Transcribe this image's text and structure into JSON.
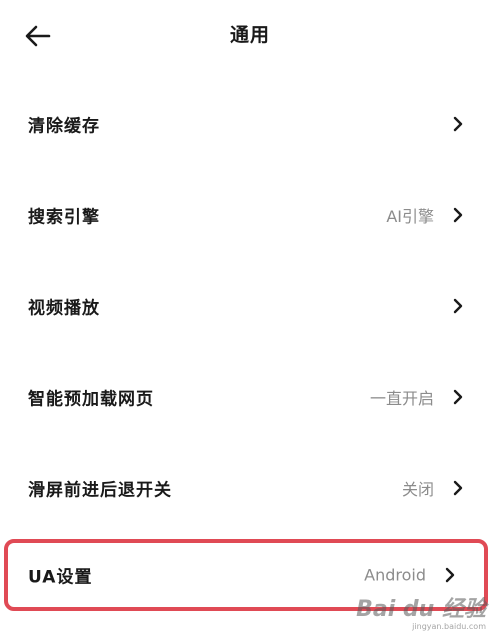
{
  "header": {
    "title": "通用",
    "back_icon": "arrow-left-icon"
  },
  "rows": [
    {
      "label": "清除缓存",
      "value": ""
    },
    {
      "label": "搜索引擎",
      "value": "AI引擎"
    },
    {
      "label": "视频播放",
      "value": ""
    },
    {
      "label": "智能预加载网页",
      "value": "一直开启"
    },
    {
      "label": "滑屏前进后退开关",
      "value": "关闭"
    },
    {
      "label": "UA设置",
      "value": "Android"
    }
  ],
  "chevron_icon": "chevron-right-icon",
  "highlight_color": "#e04a55",
  "watermark": {
    "text": "Bai du 经验",
    "sub": "jingyan.baidu.com"
  }
}
